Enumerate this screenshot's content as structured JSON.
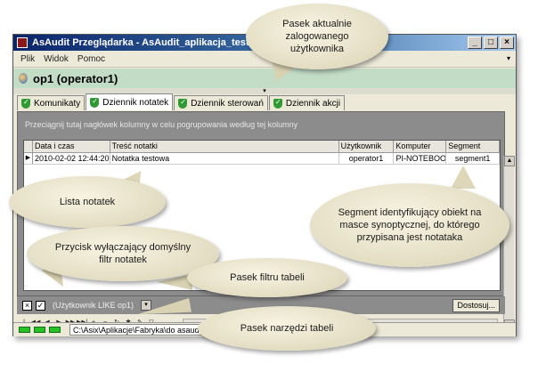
{
  "window": {
    "title": "AsAudit Przeglądarka - AsAudit_aplikacja_testowa",
    "controls": [
      "_",
      "□",
      "×"
    ]
  },
  "menu": {
    "items": [
      "Plik",
      "Widok",
      "Pomoc"
    ],
    "overflow_arrow": "▾"
  },
  "user": {
    "label": "op1 (operator1)"
  },
  "collapse_handle": "▾",
  "tabs": [
    {
      "label": "Komunikaty",
      "active": false
    },
    {
      "label": "Dziennik notatek",
      "active": true
    },
    {
      "label": "Dziennik sterowań",
      "active": false
    },
    {
      "label": "Dziennik akcji",
      "active": false
    }
  ],
  "grid": {
    "group_hint": "Przeciągnij tutaj nagłówek kolumny w celu pogrupowania według tej kolumny",
    "columns": [
      "Data i czas",
      "Treść notatki",
      "Użytkownik",
      "Komputer",
      "Segment"
    ],
    "rows": [
      {
        "indicator": "▶",
        "cells": [
          "2010-02-02 12:44:20",
          "Notatka testowa",
          "operator1",
          "PI-NOTEBOO",
          "segment1"
        ]
      }
    ]
  },
  "filter": {
    "close_glyph": "×",
    "enabled_glyph": "✓",
    "expression": "(Użytkownik LIKE op1)",
    "dropdown_glyph": "▾",
    "customize_label": "Dostosuj..."
  },
  "navigator": {
    "buttons": [
      "|◀◀",
      "◀◀",
      "◀",
      "▶",
      "▶▶",
      "▶▶|",
      "+",
      "−",
      "↻",
      "✱",
      "✎",
      "▽"
    ]
  },
  "status": {
    "path": "C:\\Asix\\Aplikacje\\Fabryka\\do asaudit"
  },
  "callouts": {
    "user_bar": "Pasek aktualnie zalogowanego użytkownika",
    "notes_list": "Lista notatek",
    "segment": "Segment identyfikujący obiekt na masce synoptycznej, do którego przypisana jest notataka",
    "filter_button": "Przycisk wyłączający domyślny filtr notatek",
    "filter_bar": "Pasek filtru tabeli",
    "toolbar": "Pasek narzędzi tabeli"
  }
}
